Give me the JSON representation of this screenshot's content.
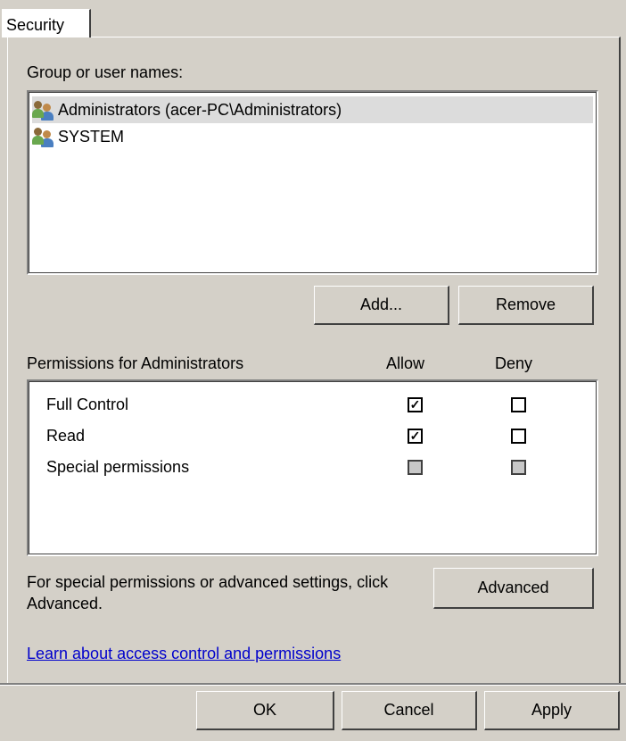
{
  "tab": {
    "label": "Security"
  },
  "group_users": {
    "label": "Group or user names:",
    "items": [
      {
        "name": "Administrators (acer-PC\\Administrators)",
        "selected": true,
        "icon": "users-icon"
      },
      {
        "name": "SYSTEM",
        "selected": false,
        "icon": "users-icon"
      }
    ],
    "add_label": "Add...",
    "remove_label": "Remove"
  },
  "permissions": {
    "title": "Permissions for Administrators",
    "allow_header": "Allow",
    "deny_header": "Deny",
    "rows": [
      {
        "name": "Full Control",
        "allow": "checked",
        "deny": "unchecked"
      },
      {
        "name": "Read",
        "allow": "checked",
        "deny": "unchecked"
      },
      {
        "name": "Special permissions",
        "allow": "disabled",
        "deny": "disabled"
      }
    ]
  },
  "advanced": {
    "note": "For special permissions or advanced settings, click Advanced.",
    "button_label": "Advanced"
  },
  "learn_link": "Learn about access control and permissions",
  "dialog_buttons": {
    "ok": "OK",
    "cancel": "Cancel",
    "apply": "Apply"
  }
}
